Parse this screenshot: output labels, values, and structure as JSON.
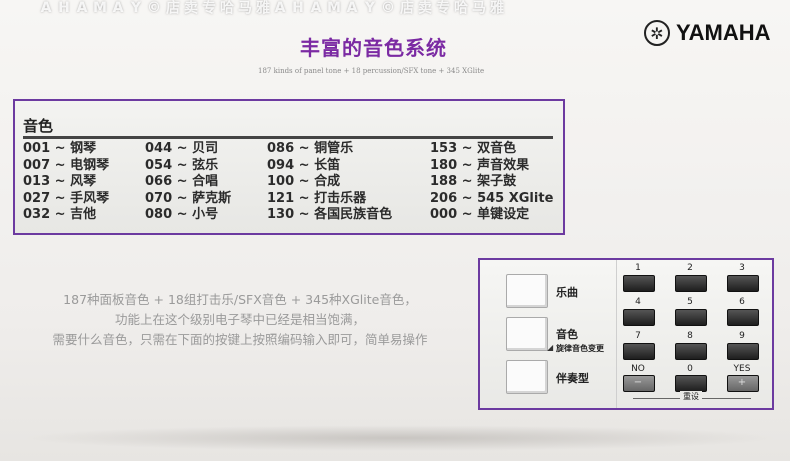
{
  "brand": {
    "logo_text": "YAMAHA",
    "logo_mark": "tuning-fork-emblem"
  },
  "headline": "丰富的音色系统",
  "subline": "187 kinds of panel tone + 18 percussion/SFX tone + 345 XGlite",
  "tone_panel": {
    "title": "音色",
    "columns": [
      [
        "001 ~ 钢琴",
        "007 ~ 电钢琴",
        "013 ~ 风琴",
        "027 ~ 手风琴",
        "032 ~ 吉他"
      ],
      [
        "044 ~ 贝司",
        "054 ~ 弦乐",
        "066 ~ 合唱",
        "070 ~ 萨克斯",
        "080 ~ 小号"
      ],
      [
        "086 ~ 铜管乐",
        "094 ~ 长笛",
        "100 ~ 合成",
        "121 ~ 打击乐器",
        "130 ~ 各国民族音色"
      ],
      [
        "153 ~ 双音色",
        "180 ~ 声音效果",
        "188 ~ 架子鼓",
        "206 ~ 545 XGlite",
        "000 ~ 单键设定"
      ]
    ]
  },
  "description": [
    "187种面板音色 + 18组打击乐/SFX音色 + 345种XGlite音色，",
    "功能上在这个级别电子琴中已经是相当饱满，",
    "需要什么音色，只需在下面的按键上按照编码输入即可，简单易操作"
  ],
  "watermark": [
    "雅",
    "马",
    "哈",
    "专",
    "卖",
    "店",
    "©",
    "Y",
    "A",
    "M",
    "A",
    "H",
    "A",
    "雅",
    "马",
    "哈",
    "专",
    "卖",
    "店",
    "©",
    "Y",
    "A",
    "M",
    "A",
    "H",
    "A"
  ],
  "keypad": {
    "categories": [
      {
        "label": "乐曲",
        "sub": ""
      },
      {
        "label": "音色",
        "sub": "旋律音色变更"
      },
      {
        "label": "伴奏型",
        "sub": ""
      }
    ],
    "keys": [
      {
        "label": "1"
      },
      {
        "label": "2"
      },
      {
        "label": "3"
      },
      {
        "label": "4"
      },
      {
        "label": "5"
      },
      {
        "label": "6"
      },
      {
        "label": "7"
      },
      {
        "label": "8"
      },
      {
        "label": "9"
      },
      {
        "label": "NO",
        "glyph": "−"
      },
      {
        "label": "0"
      },
      {
        "label": "YES",
        "glyph": "+"
      }
    ],
    "reset_label": "重设"
  }
}
